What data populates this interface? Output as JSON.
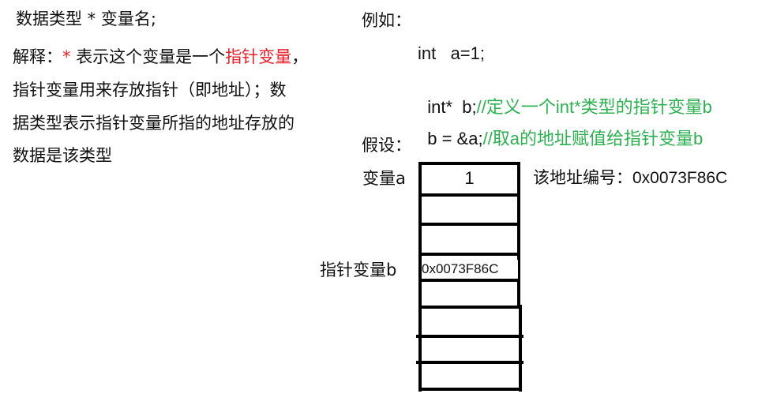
{
  "left": {
    "syntax": "数据类型 *  变量名;",
    "explain_prefix": "解释：",
    "explain_star": "* ",
    "explain_mid": "表示这个变量是一个",
    "explain_red": "指针变量",
    "explain_comma": "，",
    "explain_line2": "指针变量用来存放指针（即地址）；数",
    "explain_line3": "据类型表示指针变量所指的地址存放的",
    "explain_line4": "数据是该类型"
  },
  "example": {
    "heading": "例如：",
    "line1": "int   a=1;",
    "line2_code": "int*  b;",
    "line2_comment": "//定义一个int*类型的指针变量b",
    "line3_code": "b = &a;",
    "line3_comment": "//取a的地址赋值给指针变量b",
    "assume": "假设："
  },
  "memory": {
    "label_a": "变量a",
    "value_a": "1",
    "address_note": "该地址编号：0x0073F86C",
    "label_b": "指针变量b",
    "value_b": "0x0073F86C"
  },
  "colors": {
    "highlight_red": "#e8202a",
    "comment_green": "#2db150"
  }
}
